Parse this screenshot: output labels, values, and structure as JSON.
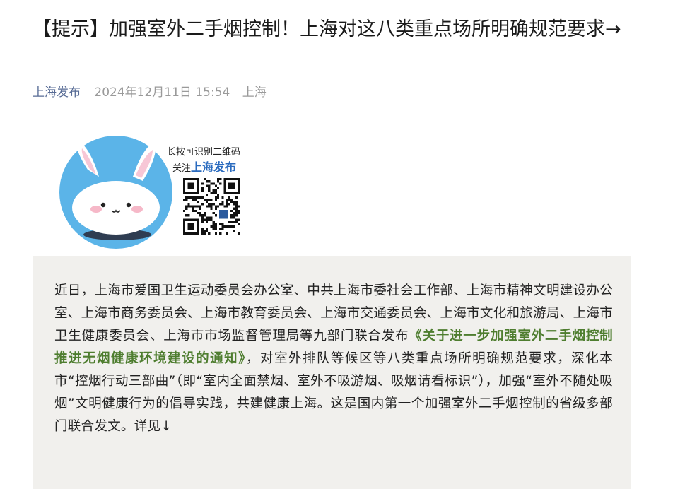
{
  "article": {
    "title": "【提示】加强室外二手烟控制！上海对这八类重点场所明确规范要求→",
    "author": "上海发布",
    "date": "2024年12月11日 15:54",
    "location": "上海"
  },
  "banner": {
    "hint_line1": "长按可识别二维码",
    "hint_prefix": "关注",
    "hint_brand": "上海发布",
    "mascot_icon": "bunny-mascot-icon",
    "qr_icon": "qr-code-icon"
  },
  "body": {
    "text_before": "近日，上海市爱国卫生运动委员会办公室、中共上海市委社会工作部、上海市精神文明建设办公室、上海市商务委员会、上海市教育委员会、上海市交通委员会、上海市文化和旅游局、上海市卫生健康委员会、上海市市场监督管理局等九部门联合发布",
    "notice_title": "《关于进一步加强室外二手烟控制 推进无烟健康环境建设的通知》",
    "text_after": "，对室外排队等候区等八类重点场所明确规范要求，深化本市“控烟行动三部曲”（即“室内全面禁烟、室外不吸游烟、吸烟请看标识”），加强“室外不随处吸烟”文明健康行为的倡导实践，共建健康上海。这是国内第一个加强室外二手烟控制的省级多部门联合发文。详见↓"
  },
  "colors": {
    "author_link": "#576b95",
    "notice_link": "#4e7d2f",
    "card_bg": "#f1f0ed",
    "mascot_bg": "#5bb4e8"
  }
}
